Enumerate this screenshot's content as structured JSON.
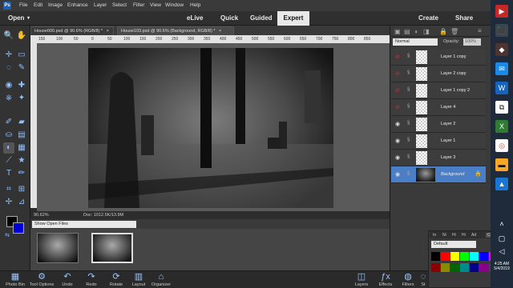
{
  "menubar": {
    "items": [
      "File",
      "Edit",
      "Image",
      "Enhance",
      "Layer",
      "Select",
      "Filter",
      "View",
      "Window",
      "Help"
    ]
  },
  "modebar": {
    "open_label": "Open",
    "modes": [
      "eLive",
      "Quick",
      "Guided",
      "Expert"
    ],
    "create_label": "Create",
    "share_label": "Share"
  },
  "doc_tabs": [
    {
      "label": "House000.psd @ 90.6% (RGB/8) *",
      "close": "×"
    },
    {
      "label": "House103.psd @ 90.6% (Background, RGB/8) *",
      "close": "×"
    }
  ],
  "ruler": {
    "ticks": [
      "150",
      "100",
      "50",
      "0",
      "50",
      "100",
      "150",
      "200",
      "250",
      "300",
      "350",
      "400",
      "450",
      "500",
      "550",
      "600",
      "650",
      "700",
      "750",
      "800",
      "850"
    ]
  },
  "statusbar": {
    "zoom": "90.62%",
    "doc_info": "Doc: 1012.5K/13.9M"
  },
  "photo_bin": {
    "show_label": "Show Open Files"
  },
  "layers_panel": {
    "blend_mode": "Normal",
    "opacity_label": "Opacity:",
    "opacity_value": "100%",
    "layers": [
      {
        "name": "Layer 1 copy",
        "visible": false
      },
      {
        "name": "Layer 2 copy",
        "visible": false
      },
      {
        "name": "Layer 1 copy 2",
        "visible": false
      },
      {
        "name": "Layer 4",
        "visible": false
      },
      {
        "name": "Layer 2",
        "visible": true
      },
      {
        "name": "Layer 1",
        "visible": true
      },
      {
        "name": "Layer 3",
        "visible": true
      },
      {
        "name": "Background",
        "visible": true,
        "selected": true
      }
    ]
  },
  "taskbar": {
    "left": [
      "Photo Bin",
      "Tool Options",
      "Undo",
      "Redo",
      "Rotate",
      "Layout",
      "Organizer"
    ],
    "right": [
      "Layers",
      "Effects",
      "Filters",
      "St"
    ]
  },
  "swatches_panel": {
    "tab_label": "Color Sw",
    "preset": "Default",
    "colors": [
      "#000000",
      "#ff0000",
      "#ffff00",
      "#00ff00",
      "#00ffff",
      "#0000ff",
      "#ff00ff",
      "#ff0000",
      "#8b0000",
      "#8b8b00",
      "#006400",
      "#008b8b",
      "#00008b",
      "#8b008b",
      "#444444",
      "#666666"
    ]
  },
  "windows": {
    "time": "4:25 AM",
    "date": "5/4/2019"
  },
  "accent_color": "#4a7fc7"
}
